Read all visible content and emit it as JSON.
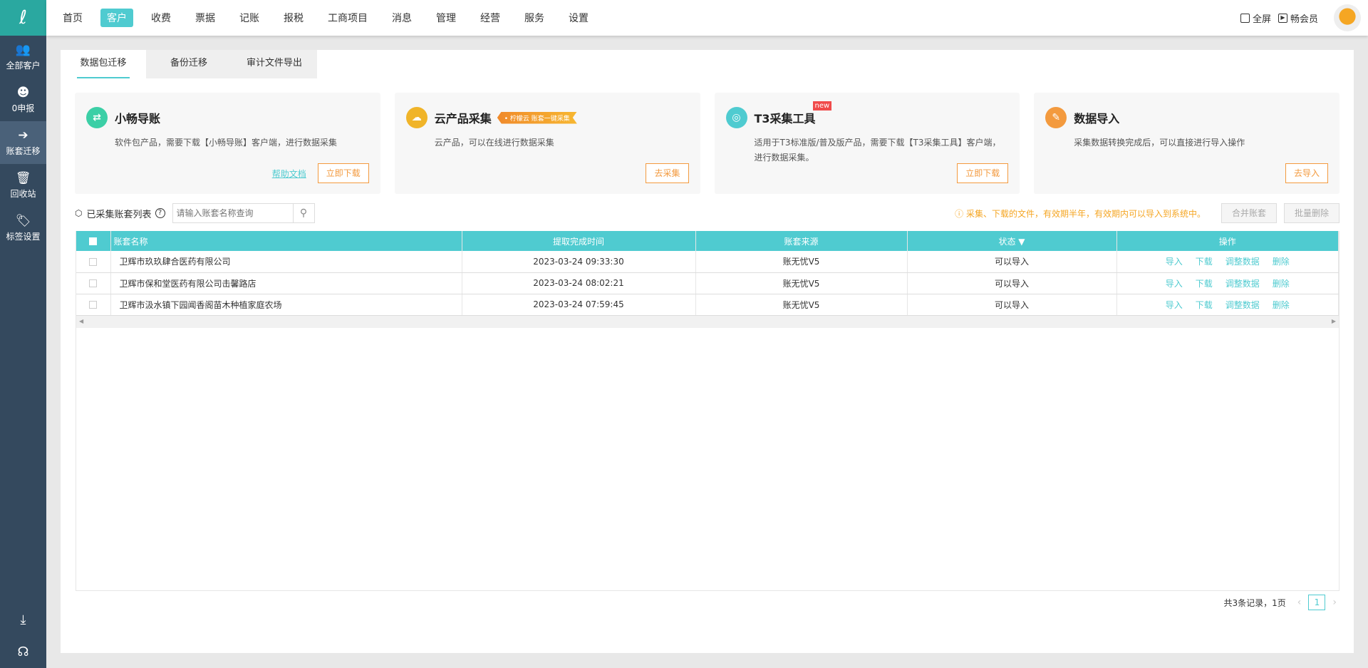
{
  "topnav": {
    "items": [
      "首页",
      "客户",
      "收费",
      "票据",
      "记账",
      "报税",
      "工商项目",
      "消息",
      "管理",
      "经营",
      "服务",
      "设置"
    ],
    "active": 1,
    "fullscreen": "全屏",
    "member": "畅会员"
  },
  "sidebar": {
    "items": [
      {
        "label": "全部客户",
        "icon": "users-icon"
      },
      {
        "label": "0申报",
        "icon": "declare-icon"
      },
      {
        "label": "账套迁移",
        "icon": "migrate-icon"
      },
      {
        "label": "回收站",
        "icon": "trash-icon"
      },
      {
        "label": "标签设置",
        "icon": "tag-icon"
      }
    ],
    "active": 2
  },
  "tabs": [
    "数据包迁移",
    "备份迁移",
    "审计文件导出"
  ],
  "cards": [
    {
      "title": "小畅导账",
      "desc": "软件包产品，需要下载【小畅导账】客户端，进行数据采集",
      "link": "帮助文档",
      "button": "立即下载",
      "color": "#3ccfa6"
    },
    {
      "title": "云产品采集",
      "badge": "• 柠檬云 账套一键采集",
      "desc": "云产品，可以在线进行数据采集",
      "button": "去采集",
      "color": "#f0b429"
    },
    {
      "title": "T3采集工具",
      "new": "new",
      "desc": "适用于T3标准版/普及版产品，需要下载【T3采集工具】客户端，进行数据采集。",
      "button": "立即下载",
      "color": "#4fcbd0"
    },
    {
      "title": "数据导入",
      "desc": "采集数据转换完成后，可以直接进行导入操作",
      "button": "去导入",
      "color": "#f39a3e"
    }
  ],
  "list": {
    "title": "已采集账套列表",
    "search_placeholder": "请输入账套名称查询",
    "tip": "ⓘ 采集、下载的文件，有效期半年，有效期内可以导入到系统中。",
    "merge": "合并账套",
    "batch_delete": "批量删除"
  },
  "table": {
    "headers": [
      "账套名称",
      "提取完成时间",
      "账套来源",
      "状态",
      "操作"
    ],
    "rows": [
      {
        "name": "卫辉市玖玖肆合医药有限公司",
        "time": "2023-03-24 09:33:30",
        "source": "账无忧V5",
        "status": "可以导入"
      },
      {
        "name": "卫辉市保和堂医药有限公司击馨路店",
        "time": "2023-03-24 08:02:21",
        "source": "账无忧V5",
        "status": "可以导入"
      },
      {
        "name": "卫辉市汲水镇下园闻香阁苗木种植家庭农场",
        "time": "2023-03-24 07:59:45",
        "source": "账无忧V5",
        "status": "可以导入"
      }
    ],
    "ops": [
      "导入",
      "下载",
      "调整数据",
      "删除"
    ]
  },
  "pagination": {
    "summary": "共3条记录，1页",
    "current": "1"
  }
}
